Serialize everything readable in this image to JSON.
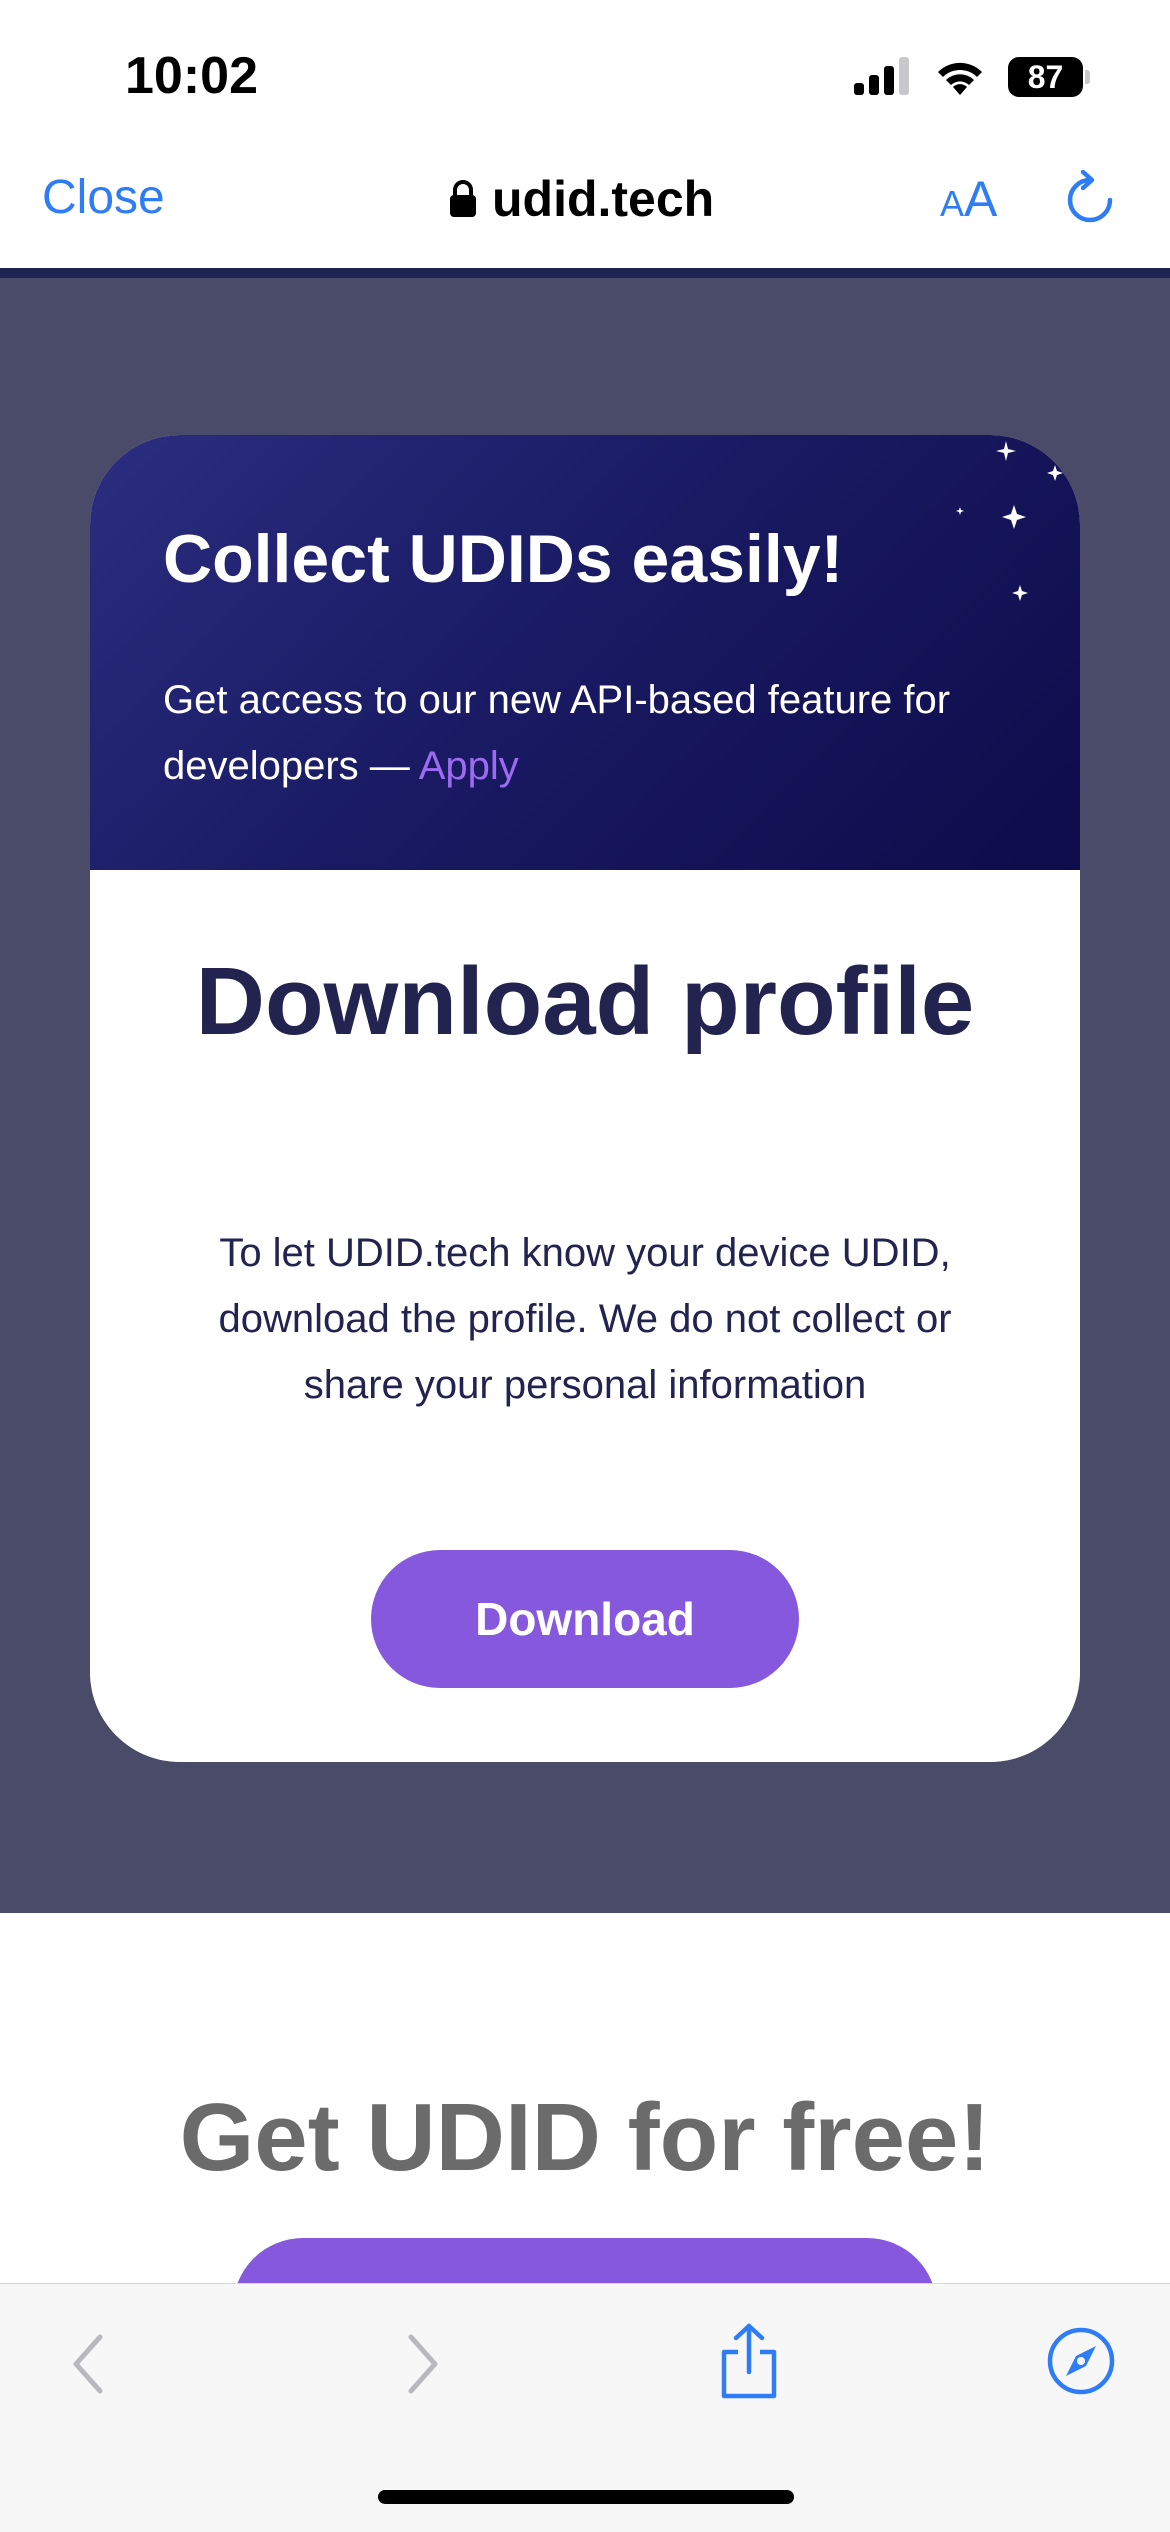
{
  "status_bar": {
    "time": "10:02",
    "battery": "87",
    "icons": [
      "cellular-signal-icon",
      "wifi-icon",
      "battery-icon"
    ]
  },
  "browser": {
    "close_label": "Close",
    "url": "udid.tech",
    "text_size_small": "A",
    "text_size_large": "A",
    "icons": [
      "lock-icon",
      "text-size-icon",
      "reload-icon"
    ],
    "accent_color": "#2f7df6"
  },
  "modal": {
    "banner": {
      "title": "Collect UDIDs easily!",
      "text": "Get access to our new API-based feature for developers — ",
      "link": "Apply"
    },
    "title": "Download profile",
    "description": "To let UDID.tech know your device UDID, download the profile. We do not collect or share your personal information",
    "download_button": "Download",
    "colors": {
      "banner_from": "#2b2d80",
      "banner_to": "#0e0b4a",
      "title": "#22244f",
      "button": "#8558de"
    }
  },
  "page": {
    "heading": "Get UDID for free!"
  },
  "toolbar": {
    "icons": [
      "back-icon",
      "forward-icon",
      "share-icon",
      "safari-compass-icon"
    ]
  }
}
